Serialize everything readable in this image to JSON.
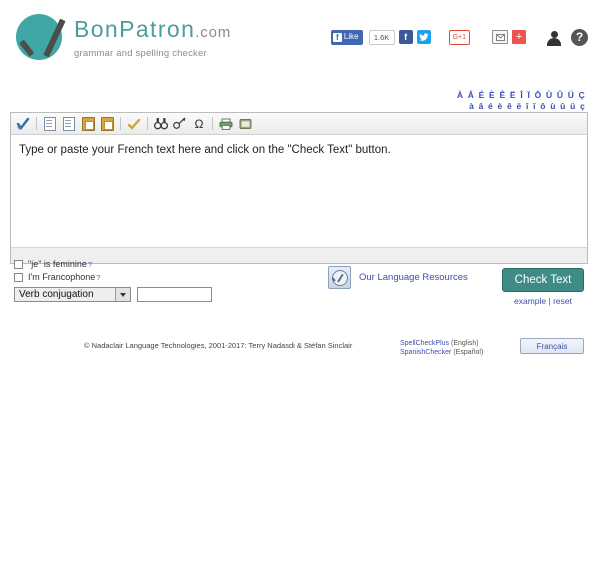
{
  "header": {
    "logo_title_main": "BonPatron",
    "logo_title_tld": ".com",
    "tagline": "grammar and spelling checker"
  },
  "social": {
    "facebook_like_label": "Like",
    "facebook_like_count": "1.6K",
    "facebook_f": "f",
    "twitter_glyph": "t",
    "google_plus_label": "G+1",
    "plus_share_label": "+",
    "icons": {
      "facebook_like": "facebook-like-icon",
      "facebook_share": "facebook-share-icon",
      "twitter_share": "twitter-share-icon",
      "google_plus": "google-plus-icon",
      "email_share": "email-share-icon",
      "addthis_share": "addthis-plus-icon",
      "account": "person-icon",
      "help": "question-mark-icon"
    },
    "help_glyph": "?"
  },
  "accents": {
    "uppercase_row": "À Â É È Ê Ë Î Ï Ô Ù Û Ü Ç",
    "lowercase_row": "à â é è ê ë î ï ô ù û ü ç"
  },
  "toolbar": {
    "icons": [
      {
        "name": "spell-check-icon",
        "title": "Check Spelling"
      },
      {
        "name": "cut-icon",
        "title": "Cut"
      },
      {
        "name": "copy-icon",
        "title": "Copy"
      },
      {
        "name": "paste-icon",
        "title": "Paste"
      },
      {
        "name": "paste-text-icon",
        "title": "Paste as plain text"
      },
      {
        "name": "select-all-icon",
        "title": "Select All"
      },
      {
        "name": "find-icon",
        "title": "Find"
      },
      {
        "name": "replace-icon",
        "title": "Replace"
      },
      {
        "name": "special-character-icon",
        "title": "Insert Special Character"
      },
      {
        "name": "print-icon",
        "title": "Print"
      },
      {
        "name": "maximize-icon",
        "title": "Maximize"
      }
    ],
    "omega_glyph": "Ω"
  },
  "editor": {
    "placeholder_text": "Type or paste your French text here and click on the \"Check Text\" button.",
    "value": ""
  },
  "options": {
    "je_is_feminine_label": "\"je\" is feminine",
    "im_francophone_label": "I'm Francophone",
    "help_marker": "?",
    "je_is_feminine_checked": false,
    "im_francophone_checked": false,
    "tool_select_value": "Verb conjugation",
    "tool_select_options": [
      "Verb conjugation"
    ],
    "tool_input_value": "",
    "tool_input_placeholder": ""
  },
  "resources": {
    "label": "Our Language Resources",
    "icon": "book-icon"
  },
  "actions": {
    "check_text_label": "Check Text",
    "example_label": "example",
    "reset_label": "reset",
    "separator": "|"
  },
  "footer": {
    "copyright": "© Nadaclair Language Technologies, 2001-2017: Terry Nadasdi & Stéfan Sinclair",
    "links": [
      {
        "name": "SpellCheckPlus",
        "lang": "(English)"
      },
      {
        "name": "SpanishChecker",
        "lang": "(Español)"
      }
    ],
    "language_button": "Français"
  },
  "colors": {
    "brand_teal": "#3FA8A4",
    "button_teal": "#3f8c86",
    "link_blue": "#3b4fb0",
    "facebook_blue": "#4267B2",
    "twitter_blue": "#1da1f2",
    "google_red": "#dd4b39"
  }
}
